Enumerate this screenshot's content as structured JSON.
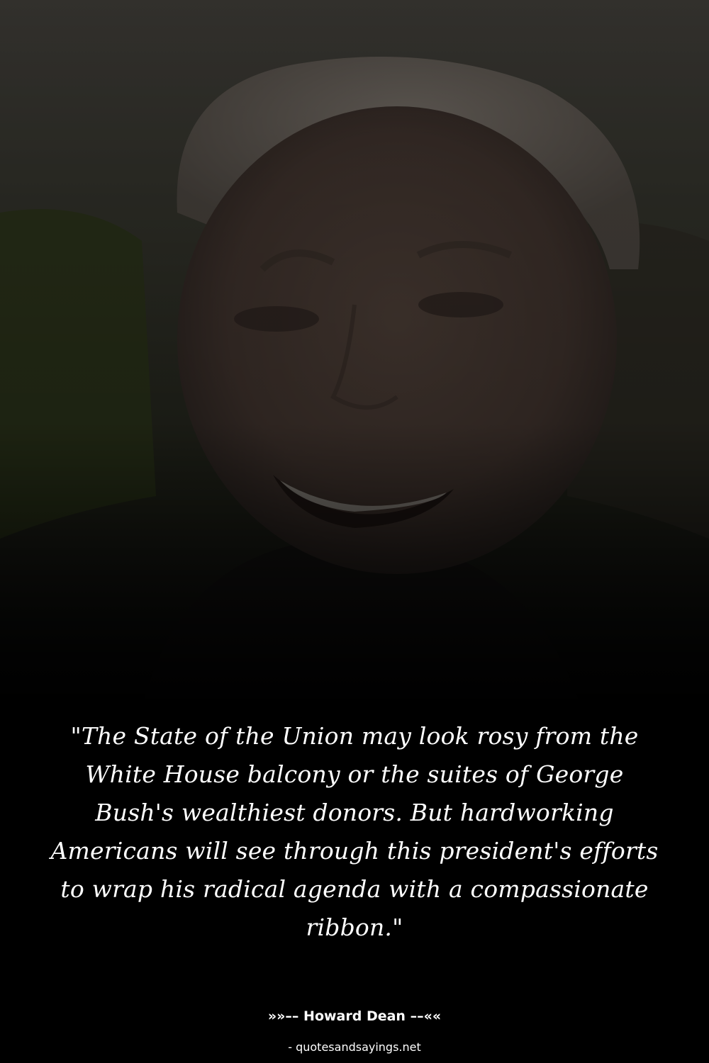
{
  "photo": {
    "subject": "smiling-man-portrait",
    "colors": {
      "overlay": "#000000",
      "grass": "#3a4226",
      "skin": "#6a5448",
      "hair": "#8a8078",
      "sky": "#5e5a52"
    }
  },
  "quote": {
    "text": "\"The State of the Union may look rosy from the White House balcony or the suites of George Bush's wealthiest donors. But hardworking Americans will see through this president's efforts to wrap his radical agenda with a compassionate ribbon.\""
  },
  "attribution": {
    "author_line": "»»–– Howard Dean ––««"
  },
  "footer": {
    "source": "- quotesandsayings.net"
  }
}
